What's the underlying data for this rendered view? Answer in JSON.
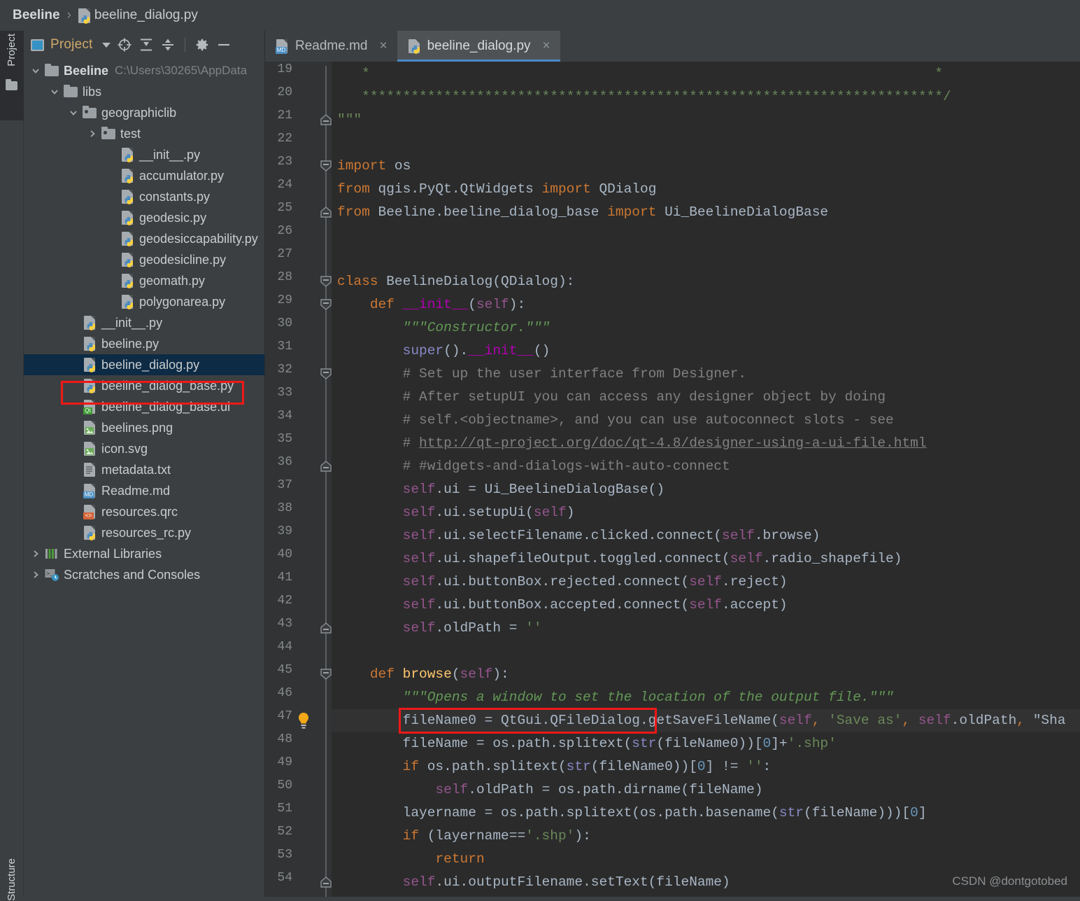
{
  "breadcrumb": {
    "root": "Beeline",
    "separator": "›",
    "file": "beeline_dialog.py",
    "file_icon": "python-file-icon"
  },
  "tool_strip": {
    "project_tab": "Project",
    "structure_tab": "Structure",
    "project_tab_icon": "folder-icon"
  },
  "project_panel": {
    "toolbar": {
      "title": "Project",
      "icons": [
        "project-view-icon",
        "chevron-down-icon",
        "locate-target-icon",
        "collapse-all-icon",
        "expand-all-icon",
        "gear-icon",
        "minimize-icon"
      ]
    },
    "tree": [
      {
        "label": "Beeline",
        "path": "C:\\Users\\30265\\AppData",
        "icon": "folder-icon",
        "twisty": "∨",
        "indent": 0,
        "bold": true,
        "selected": false
      },
      {
        "label": "libs",
        "path": "",
        "icon": "folder-icon",
        "twisty": "∨",
        "indent": 1,
        "bold": false,
        "selected": false
      },
      {
        "label": "geographiclib",
        "path": "",
        "icon": "source-folder-icon",
        "twisty": "∨",
        "indent": 2,
        "bold": false,
        "selected": false
      },
      {
        "label": "test",
        "path": "",
        "icon": "source-folder-icon",
        "twisty": "›",
        "indent": 3,
        "bold": false,
        "selected": false
      },
      {
        "label": "__init__.py",
        "path": "",
        "icon": "python-file-icon",
        "twisty": "",
        "indent": 4,
        "bold": false,
        "selected": false
      },
      {
        "label": "accumulator.py",
        "path": "",
        "icon": "python-file-icon",
        "twisty": "",
        "indent": 4,
        "bold": false,
        "selected": false
      },
      {
        "label": "constants.py",
        "path": "",
        "icon": "python-file-icon",
        "twisty": "",
        "indent": 4,
        "bold": false,
        "selected": false
      },
      {
        "label": "geodesic.py",
        "path": "",
        "icon": "python-file-icon",
        "twisty": "",
        "indent": 4,
        "bold": false,
        "selected": false
      },
      {
        "label": "geodesiccapability.py",
        "path": "",
        "icon": "python-file-icon",
        "twisty": "",
        "indent": 4,
        "bold": false,
        "selected": false
      },
      {
        "label": "geodesicline.py",
        "path": "",
        "icon": "python-file-icon",
        "twisty": "",
        "indent": 4,
        "bold": false,
        "selected": false
      },
      {
        "label": "geomath.py",
        "path": "",
        "icon": "python-file-icon",
        "twisty": "",
        "indent": 4,
        "bold": false,
        "selected": false
      },
      {
        "label": "polygonarea.py",
        "path": "",
        "icon": "python-file-icon",
        "twisty": "",
        "indent": 4,
        "bold": false,
        "selected": false
      },
      {
        "label": "__init__.py",
        "path": "",
        "icon": "python-file-icon",
        "twisty": "",
        "indent": 2,
        "bold": false,
        "selected": false
      },
      {
        "label": "beeline.py",
        "path": "",
        "icon": "python-file-icon",
        "twisty": "",
        "indent": 2,
        "bold": false,
        "selected": false
      },
      {
        "label": "beeline_dialog.py",
        "path": "",
        "icon": "python-file-icon",
        "twisty": "",
        "indent": 2,
        "bold": false,
        "selected": true
      },
      {
        "label": "beeline_dialog_base.py",
        "path": "",
        "icon": "python-file-icon",
        "twisty": "",
        "indent": 2,
        "bold": false,
        "selected": false
      },
      {
        "label": "beeline_dialog_base.ui",
        "path": "",
        "icon": "qt-ui-file-icon",
        "twisty": "",
        "indent": 2,
        "bold": false,
        "selected": false
      },
      {
        "label": "beelines.png",
        "path": "",
        "icon": "image-file-icon",
        "twisty": "",
        "indent": 2,
        "bold": false,
        "selected": false
      },
      {
        "label": "icon.svg",
        "path": "",
        "icon": "image-file-icon",
        "twisty": "",
        "indent": 2,
        "bold": false,
        "selected": false
      },
      {
        "label": "metadata.txt",
        "path": "",
        "icon": "text-file-icon",
        "twisty": "",
        "indent": 2,
        "bold": false,
        "selected": false
      },
      {
        "label": "Readme.md",
        "path": "",
        "icon": "markdown-file-icon",
        "twisty": "",
        "indent": 2,
        "bold": false,
        "selected": false
      },
      {
        "label": "resources.qrc",
        "path": "",
        "icon": "qrc-file-icon",
        "twisty": "",
        "indent": 2,
        "bold": false,
        "selected": false
      },
      {
        "label": "resources_rc.py",
        "path": "",
        "icon": "python-file-icon",
        "twisty": "",
        "indent": 2,
        "bold": false,
        "selected": false
      },
      {
        "label": "External Libraries",
        "path": "",
        "icon": "libraries-icon",
        "twisty": "›",
        "indent": 0,
        "bold": false,
        "selected": false
      },
      {
        "label": "Scratches and Consoles",
        "path": "",
        "icon": "scratches-icon",
        "twisty": "›",
        "indent": 0,
        "bold": false,
        "selected": false
      }
    ],
    "selection_highlight_color": "#f01818"
  },
  "editor": {
    "tabs": [
      {
        "label": "Readme.md",
        "icon": "markdown-file-icon",
        "close": "×",
        "active": false
      },
      {
        "label": "beeline_dialog.py",
        "icon": "python-file-icon",
        "close": "×",
        "active": true
      }
    ],
    "first_line_number": 19,
    "line_numbers": [
      19,
      20,
      21,
      22,
      23,
      24,
      25,
      26,
      27,
      28,
      29,
      30,
      31,
      32,
      33,
      34,
      35,
      36,
      37,
      38,
      39,
      40,
      41,
      42,
      43,
      44,
      45,
      46,
      47,
      48,
      49,
      50,
      51,
      52,
      53,
      54
    ],
    "gutter_icons": {
      "inspection_bulb": "lightbulb-icon",
      "fold_marker": "fold-marker-icon"
    },
    "highlight_color": "#f01818",
    "lines": [
      {
        "n": 19,
        "text": "   *                                                                     *"
      },
      {
        "n": 20,
        "text": "   ***********************************************************************/"
      },
      {
        "n": 21,
        "text": "\"\"\""
      },
      {
        "n": 22,
        "text": ""
      },
      {
        "n": 23,
        "text": "import os"
      },
      {
        "n": 24,
        "text": "from qgis.PyQt.QtWidgets import QDialog"
      },
      {
        "n": 25,
        "text": "from Beeline.beeline_dialog_base import Ui_BeelineDialogBase"
      },
      {
        "n": 26,
        "text": ""
      },
      {
        "n": 27,
        "text": ""
      },
      {
        "n": 28,
        "text": "class BeelineDialog(QDialog):"
      },
      {
        "n": 29,
        "text": "    def __init__(self):"
      },
      {
        "n": 30,
        "text": "        \"\"\"Constructor.\"\"\""
      },
      {
        "n": 31,
        "text": "        super().__init__()"
      },
      {
        "n": 32,
        "text": "        # Set up the user interface from Designer."
      },
      {
        "n": 33,
        "text": "        # After setupUI you can access any designer object by doing"
      },
      {
        "n": 34,
        "text": "        # self.<objectname>, and you can use autoconnect slots - see"
      },
      {
        "n": 35,
        "text": "        # http://qt-project.org/doc/qt-4.8/designer-using-a-ui-file.html"
      },
      {
        "n": 36,
        "text": "        # #widgets-and-dialogs-with-auto-connect"
      },
      {
        "n": 37,
        "text": "        self.ui = Ui_BeelineDialogBase()"
      },
      {
        "n": 38,
        "text": "        self.ui.setupUi(self)"
      },
      {
        "n": 39,
        "text": "        self.ui.selectFilename.clicked.connect(self.browse)"
      },
      {
        "n": 40,
        "text": "        self.ui.shapefileOutput.toggled.connect(self.radio_shapefile)"
      },
      {
        "n": 41,
        "text": "        self.ui.buttonBox.rejected.connect(self.reject)"
      },
      {
        "n": 42,
        "text": "        self.ui.buttonBox.accepted.connect(self.accept)"
      },
      {
        "n": 43,
        "text": "        self.oldPath = ''"
      },
      {
        "n": 44,
        "text": ""
      },
      {
        "n": 45,
        "text": "    def browse(self):"
      },
      {
        "n": 46,
        "text": "        \"\"\"Opens a window to set the location of the output file.\"\"\""
      },
      {
        "n": 47,
        "text": "        fileName0 = QtGui.QFileDialog.getSaveFileName(self, 'Save as', self.oldPath, \"Sha"
      },
      {
        "n": 48,
        "text": "        fileName = os.path.splitext(str(fileName0))[0]+'.shp'"
      },
      {
        "n": 49,
        "text": "        if os.path.splitext(str(fileName0))[0] != '':"
      },
      {
        "n": 50,
        "text": "            self.oldPath = os.path.dirname(fileName)"
      },
      {
        "n": 51,
        "text": "        layername = os.path.splitext(os.path.basename(str(fileName)))[0]"
      },
      {
        "n": 52,
        "text": "        if (layername=='.shp'):"
      },
      {
        "n": 53,
        "text": "            return"
      },
      {
        "n": 54,
        "text": "        self.ui.outputFilename.setText(fileName)"
      }
    ]
  },
  "watermark": "CSDN @dontgotobed"
}
